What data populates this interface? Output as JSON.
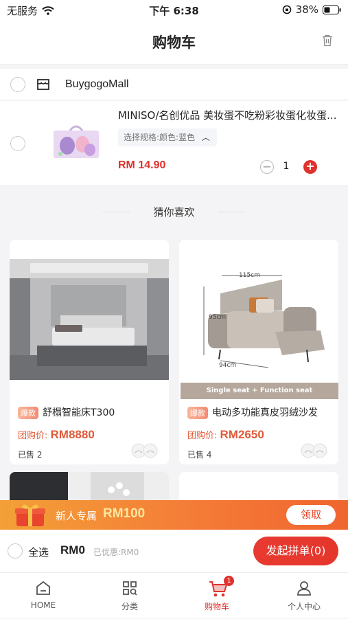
{
  "status_bar": {
    "carrier": "无服务",
    "time": "下午 6:38",
    "battery": "38%"
  },
  "header": {
    "title": "购物车"
  },
  "cart": {
    "store_name": "BuygogoMall",
    "item": {
      "title": "MINISO/名创优品 美妆蛋不吃粉彩妆蛋化妆蛋...",
      "spec": "选择规格:颜色:蓝色",
      "price": "RM 14.90",
      "quantity": "1"
    }
  },
  "recommend": {
    "heading": "猜你喜欢",
    "cards": [
      {
        "tag": "爆款",
        "title": "舒榻智能床T300",
        "price_label": "团购价:",
        "price": "RM8880",
        "sold": "已售 2"
      },
      {
        "tag": "爆款",
        "title": "电动多功能真皮羽绒沙发",
        "price_label": "团购价:",
        "price": "RM2650",
        "sold": "已售 4",
        "img_caption": "Single seat + Function seat",
        "dim_width": "115cm",
        "dim_height": "95cm",
        "dim_depth": "94cm"
      }
    ]
  },
  "banner": {
    "text": "新人专属",
    "amount": "RM100",
    "button": "领取"
  },
  "checkout": {
    "select_all": "全选",
    "total": "RM0",
    "discount": "已优惠:RM0",
    "submit": "发起拼单(0)"
  },
  "tabbar": {
    "tabs": [
      {
        "label": "HOME",
        "icon": "home-icon"
      },
      {
        "label": "分类",
        "icon": "category-icon"
      },
      {
        "label": "购物车",
        "icon": "cart-icon",
        "badge": "1"
      },
      {
        "label": "个人中心",
        "icon": "user-icon"
      }
    ]
  },
  "colors": {
    "accent": "#e0312d",
    "banner_start": "#f3a037",
    "banner_end": "#f0652f"
  }
}
